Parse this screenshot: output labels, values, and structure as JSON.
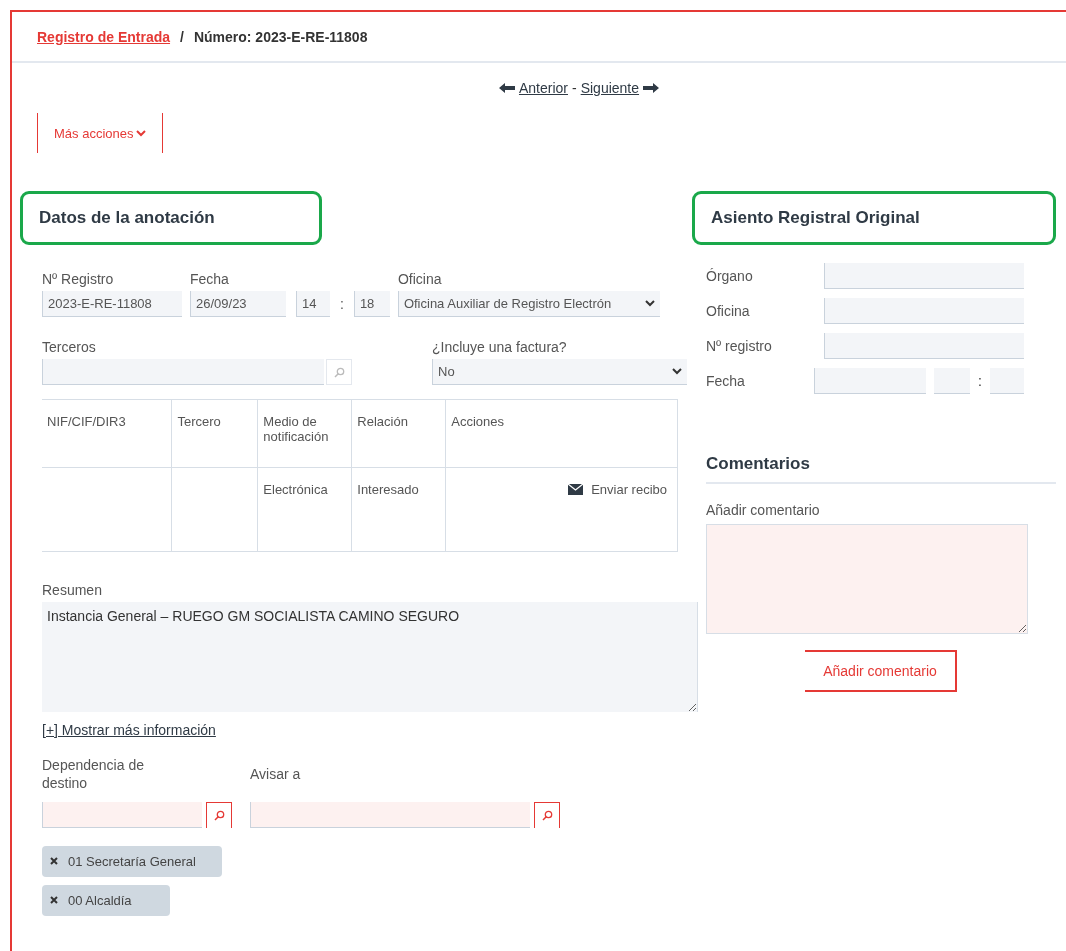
{
  "breadcrumb": {
    "link": "Registro de Entrada",
    "separator": "/",
    "current": "Número: 2023-E-RE-11808"
  },
  "nav": {
    "previous": "Anterior",
    "dash": "-",
    "next": "Siguiente"
  },
  "actions_button": "Más acciones",
  "annotation": {
    "title": "Datos de la anotación",
    "registro": {
      "label": "Nº Registro",
      "value": "2023-E-RE-11808"
    },
    "fecha": {
      "label": "Fecha",
      "date": "26/09/23",
      "hour": "14",
      "separator": ":",
      "minute": "18"
    },
    "oficina": {
      "label": "Oficina",
      "value": "Oficina Auxiliar de Registro Electrón"
    },
    "terceros": {
      "label": "Terceros"
    },
    "factura": {
      "label": "¿Incluye una factura?",
      "value": "No"
    },
    "table": {
      "columns": [
        "NIF/CIF/DIR3",
        "Tercero",
        "Medio de notificación",
        "Relación",
        "Acciones"
      ],
      "rows": [
        {
          "medio": "Electrónica",
          "relacion": "Interesado",
          "action": "Enviar recibo"
        }
      ]
    },
    "resumen": {
      "label": "Resumen",
      "value": "Instancia General – RUEGO GM SOCIALISTA CAMINO SEGURO"
    },
    "more_info": "[+] Mostrar más información",
    "dependencia": {
      "label": "Dependencia de destino",
      "tags": [
        "01 Secretaría General",
        "00 Alcaldía"
      ]
    },
    "avisar": {
      "label": "Avisar a"
    }
  },
  "asiento": {
    "title": "Asiento Registral Original",
    "fields": [
      {
        "label": "Órgano",
        "kind": "text"
      },
      {
        "label": "Oficina",
        "kind": "text"
      },
      {
        "label": "Nº registro",
        "kind": "text"
      },
      {
        "label": "Fecha",
        "kind": "datetime",
        "separator": ":"
      }
    ]
  },
  "comentarios": {
    "title": "Comentarios",
    "field_label": "Añadir comentario",
    "button": "Añadir comentario"
  }
}
